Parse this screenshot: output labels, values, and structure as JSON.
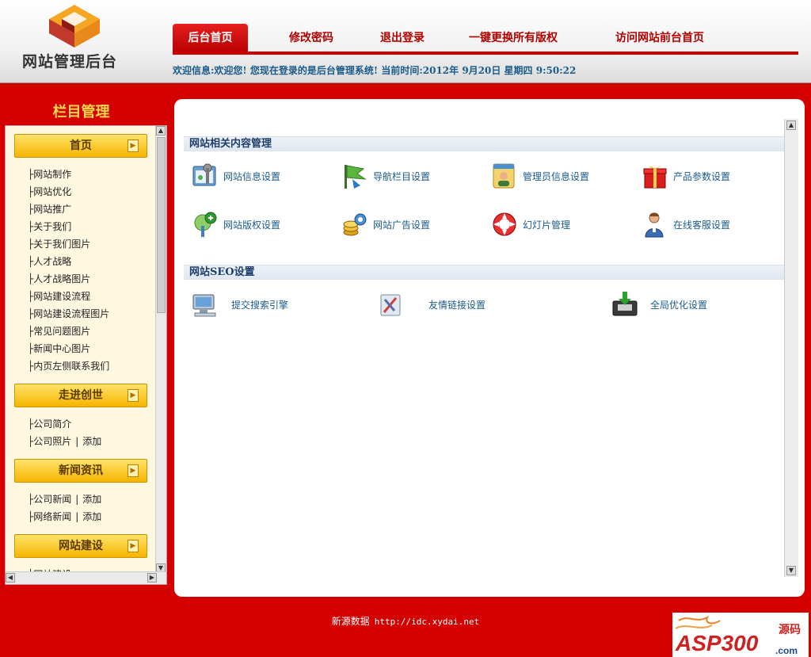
{
  "logo": {
    "text": "网站管理后台"
  },
  "nav": {
    "tabs": [
      {
        "label": "后台首页",
        "active": true
      },
      {
        "label": "修改密码"
      },
      {
        "label": "退出登录"
      },
      {
        "label": "一键更换所有版权"
      },
      {
        "label": "访问网站前台首页"
      }
    ]
  },
  "welcome": "欢迎信息:欢迎您! 您现在登录的是后台管理系统! 当前时间:2012年 9月20日 星期四 9:50:22",
  "sidebar": {
    "title": "栏目管理",
    "groups": [
      {
        "label": "首页",
        "items": [
          "├网站制作",
          "├网站优化",
          "├网站推广",
          "├关于我们",
          "├关于我们图片",
          "├人才战略",
          "├人才战略图片",
          "├网站建设流程",
          "├网站建设流程图片",
          "├常见问题图片",
          "├新闻中心图片",
          "├内页左侧联系我们"
        ]
      },
      {
        "label": "走进创世",
        "items": [
          "├公司简介"
        ],
        "items_add": [
          {
            "label": "├公司照片",
            "add": "添加"
          }
        ]
      },
      {
        "label": "新闻资讯",
        "items_add": [
          {
            "label": "├公司新闻",
            "add": "添加"
          },
          {
            "label": "├网络新闻",
            "add": "添加"
          }
        ]
      },
      {
        "label": "网站建设",
        "items": [
          "├网站建设"
        ]
      }
    ]
  },
  "main": {
    "section1": {
      "title": "网站相关内容管理",
      "tiles": [
        {
          "label": "网站信息设置",
          "icon": "settings-window-icon"
        },
        {
          "label": "导航栏目设置",
          "icon": "flag-icon"
        },
        {
          "label": "管理员信息设置",
          "icon": "admin-user-icon"
        },
        {
          "label": "产品参数设置",
          "icon": "gift-box-icon"
        },
        {
          "label": "网站版权设置",
          "icon": "add-pin-icon"
        },
        {
          "label": "网站广告设置",
          "icon": "coins-gear-icon"
        },
        {
          "label": "幻灯片管理",
          "icon": "lifebuoy-icon"
        },
        {
          "label": "在线客服设置",
          "icon": "support-person-icon"
        }
      ]
    },
    "section2": {
      "title": "网站SEO设置",
      "tiles": [
        {
          "label": "提交搜索引擎",
          "icon": "computer-icon"
        },
        {
          "label": "友情链接设置",
          "icon": "link-tools-icon"
        },
        {
          "label": "全局优化设置",
          "icon": "download-archive-icon"
        }
      ]
    }
  },
  "footer": {
    "text": "新源数据",
    "url": "http://idc.xydai.net"
  },
  "brand": {
    "text": "ASP300",
    "sub": "源码",
    "domain": ".com"
  },
  "colors": {
    "primary": "#cc0000",
    "accent": "#f5b500",
    "link": "#1a5b8a"
  }
}
